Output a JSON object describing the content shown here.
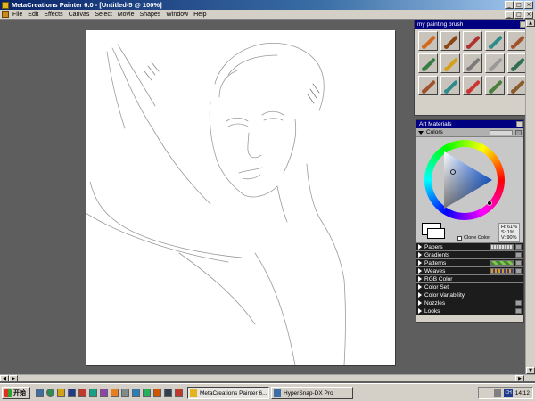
{
  "window": {
    "title": "MetaCreations Painter 6.0 - [Untitled-5 @ 100%]",
    "buttons": [
      "_",
      "□",
      "×"
    ]
  },
  "menu": {
    "items": [
      "File",
      "Edit",
      "Effects",
      "Canvas",
      "Select",
      "Movie",
      "Shapes",
      "Window",
      "Help"
    ],
    "doc_buttons": [
      "_",
      "□",
      "×"
    ]
  },
  "brush_panel": {
    "title": "my painting brush",
    "tiles": [
      {
        "color": "#d2691e"
      },
      {
        "color": "#8b4513"
      },
      {
        "color": "#b03030"
      },
      {
        "color": "#2e8b8b"
      },
      {
        "color": "#a0522d"
      },
      {
        "color": "#3a7d44"
      },
      {
        "color": "#d4a017"
      },
      {
        "color": "#7a7a7a"
      },
      {
        "color": "#9a9a9a"
      },
      {
        "color": "#2f6f4f"
      },
      {
        "color": "#a0522d"
      },
      {
        "color": "#2e8b8b"
      },
      {
        "color": "#cc3333"
      },
      {
        "color": "#4a7f3f"
      },
      {
        "color": "#8b5a2b"
      }
    ]
  },
  "art_materials": {
    "title": "Art Materials",
    "colors_label": "Colors",
    "clone_color_label": "Clone Color",
    "hsv": {
      "h": "H: 61%",
      "s": "S: 1%",
      "v": "V: 90%"
    },
    "sections": [
      "Papers",
      "Gradients",
      "Patterns",
      "Weaves",
      "RGB Color",
      "Color Set",
      "Color Variability",
      "Nozzles",
      "Looks"
    ]
  },
  "taskbar": {
    "start_label": "开始",
    "tasks": [
      {
        "label": "MetaCreations Painter 6...",
        "active": true
      },
      {
        "label": "HyperSnap-DX Pro",
        "active": false
      }
    ],
    "tray_lang": "CH",
    "clock": "14:12"
  }
}
